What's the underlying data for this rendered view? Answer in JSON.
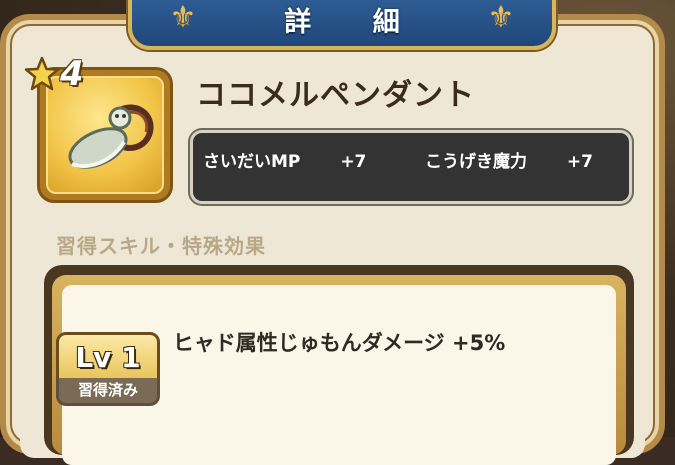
{
  "header": {
    "title": "詳 細"
  },
  "item": {
    "rank": "4",
    "name": "ココメルペンダント",
    "icon": "pendant-icon",
    "stats": [
      {
        "label": "さいだいMP",
        "value": "+7"
      },
      {
        "label": "こうげき魔力",
        "value": "+7"
      }
    ]
  },
  "skills_section": {
    "heading": "習得スキル・特殊効果",
    "skill": {
      "description": "ヒャド属性じゅもんダメージ +5%",
      "level_label": "Lv 1",
      "status_label": "習得済み"
    }
  },
  "colors": {
    "banner_blue": "#2f5e95",
    "gold": "#d9b55a",
    "parchment": "#efe6d3",
    "stats_bg": "#333333"
  }
}
